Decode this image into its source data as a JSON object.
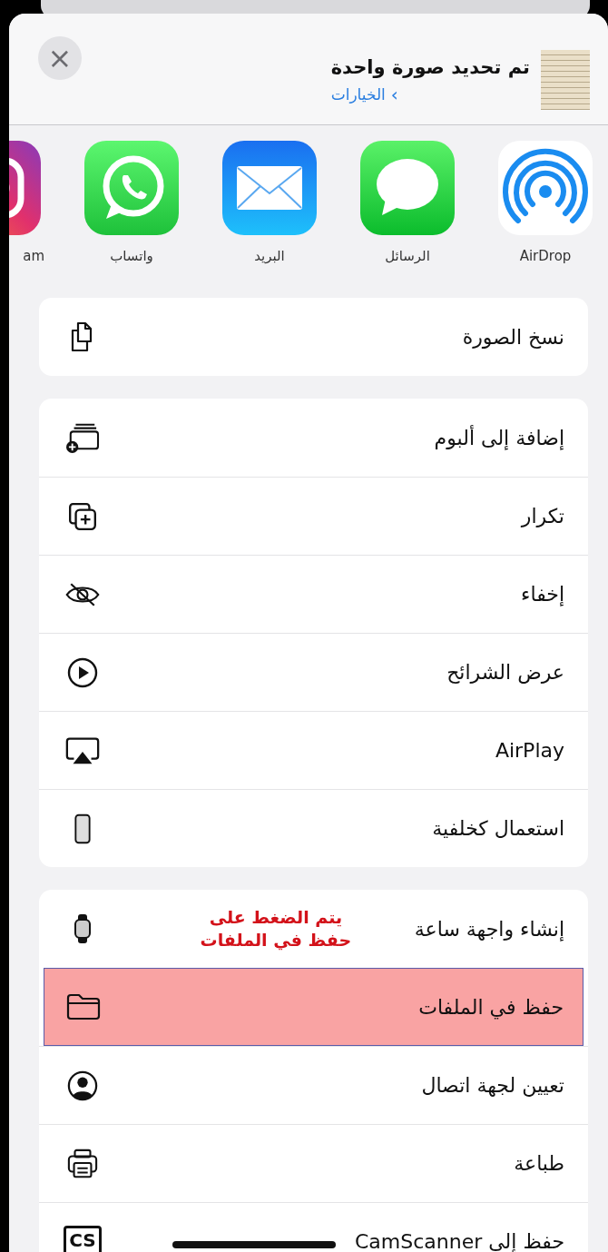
{
  "header": {
    "title": "تم تحديد صورة واحدة",
    "options_link": "الخيارات",
    "chevron": "›",
    "close": "×"
  },
  "apps": [
    {
      "kind": "airdrop",
      "label": "AirDrop"
    },
    {
      "kind": "messages",
      "label": "الرسائل"
    },
    {
      "kind": "mail",
      "label": "البريد"
    },
    {
      "kind": "whatsapp",
      "label": "واتساب"
    },
    {
      "kind": "instagram",
      "label": "am"
    }
  ],
  "groups": [
    {
      "items": [
        {
          "kind": "copy",
          "label": "نسخ الصورة",
          "highlighted": false
        }
      ]
    },
    {
      "items": [
        {
          "kind": "album",
          "label": "إضافة إلى ألبوم",
          "highlighted": false
        },
        {
          "kind": "duplicate",
          "label": "تكرار",
          "highlighted": false
        },
        {
          "kind": "hide",
          "label": "إخفاء",
          "highlighted": false
        },
        {
          "kind": "slideshow",
          "label": "عرض الشرائح",
          "highlighted": false
        },
        {
          "kind": "airplay",
          "label": "AirPlay",
          "highlighted": false
        },
        {
          "kind": "wallpaper",
          "label": "استعمال كخلفية",
          "highlighted": false
        }
      ]
    },
    {
      "items": [
        {
          "kind": "watch",
          "label": "إنشاء واجهة ساعة",
          "highlighted": false,
          "annotation": "يتم الضغط على\nحفظ في الملفات"
        },
        {
          "kind": "files",
          "label": "حفظ في الملفات",
          "highlighted": true
        },
        {
          "kind": "contact",
          "label": "تعيين لجهة اتصال",
          "highlighted": false
        },
        {
          "kind": "print",
          "label": "طباعة",
          "highlighted": false
        },
        {
          "kind": "camscanner",
          "label": "حفظ إلى CamScanner",
          "highlighted": false,
          "badge": "CS"
        }
      ]
    }
  ]
}
